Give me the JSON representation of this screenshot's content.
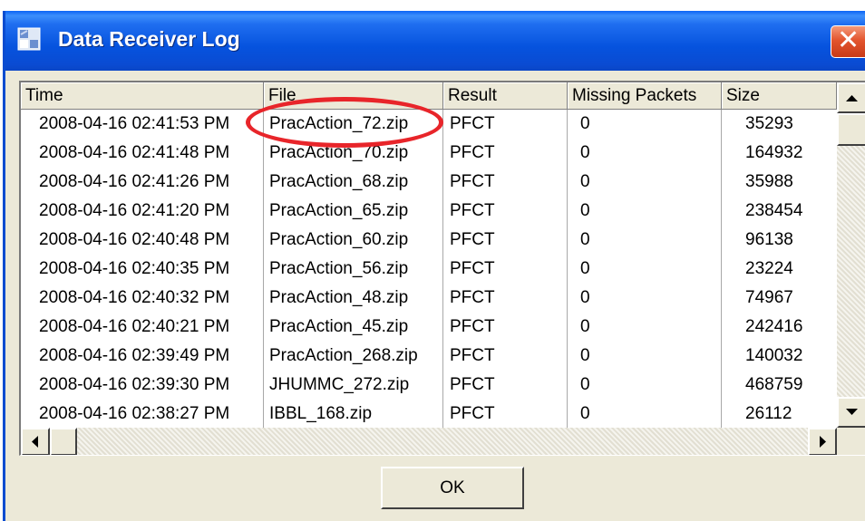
{
  "window": {
    "title": "Data Receiver Log",
    "close_glyph": "✕"
  },
  "columns": [
    {
      "label": "Time"
    },
    {
      "label": "File"
    },
    {
      "label": "Result"
    },
    {
      "label": "Missing Packets"
    },
    {
      "label": "Size"
    }
  ],
  "rows": [
    {
      "time": "2008-04-16  02:41:53 PM",
      "file": "PracAction_72.zip",
      "result": "PFCT",
      "missing": "0",
      "size": "35293"
    },
    {
      "time": "2008-04-16  02:41:48 PM",
      "file": "PracAction_70.zip",
      "result": "PFCT",
      "missing": "0",
      "size": "164932"
    },
    {
      "time": "2008-04-16  02:41:26 PM",
      "file": "PracAction_68.zip",
      "result": "PFCT",
      "missing": "0",
      "size": "35988"
    },
    {
      "time": "2008-04-16  02:41:20 PM",
      "file": "PracAction_65.zip",
      "result": "PFCT",
      "missing": "0",
      "size": "238454"
    },
    {
      "time": "2008-04-16  02:40:48 PM",
      "file": "PracAction_60.zip",
      "result": "PFCT",
      "missing": "0",
      "size": "96138"
    },
    {
      "time": "2008-04-16  02:40:35 PM",
      "file": "PracAction_56.zip",
      "result": "PFCT",
      "missing": "0",
      "size": "23224"
    },
    {
      "time": "2008-04-16  02:40:32 PM",
      "file": "PracAction_48.zip",
      "result": "PFCT",
      "missing": "0",
      "size": "74967"
    },
    {
      "time": "2008-04-16  02:40:21 PM",
      "file": "PracAction_45.zip",
      "result": "PFCT",
      "missing": "0",
      "size": "242416"
    },
    {
      "time": "2008-04-16  02:39:49 PM",
      "file": "PracAction_268.zip",
      "result": "PFCT",
      "missing": "0",
      "size": "140032"
    },
    {
      "time": "2008-04-16  02:39:30 PM",
      "file": "JHUMMC_272.zip",
      "result": "PFCT",
      "missing": "0",
      "size": "468759"
    },
    {
      "time": "2008-04-16  02:38:27 PM",
      "file": "IBBL_168.zip",
      "result": "PFCT",
      "missing": "0",
      "size": "26112"
    }
  ],
  "buttons": {
    "ok_label": "OK"
  },
  "icons": {
    "title": "log-window-icon",
    "close": "close-icon",
    "scroll_up": "arrow-up-icon",
    "scroll_down": "arrow-down-icon",
    "scroll_left": "arrow-left-icon",
    "scroll_right": "arrow-right-icon"
  },
  "colors": {
    "titlebar": "#0a4cd0",
    "highlight_annotation": "#e8252a"
  }
}
